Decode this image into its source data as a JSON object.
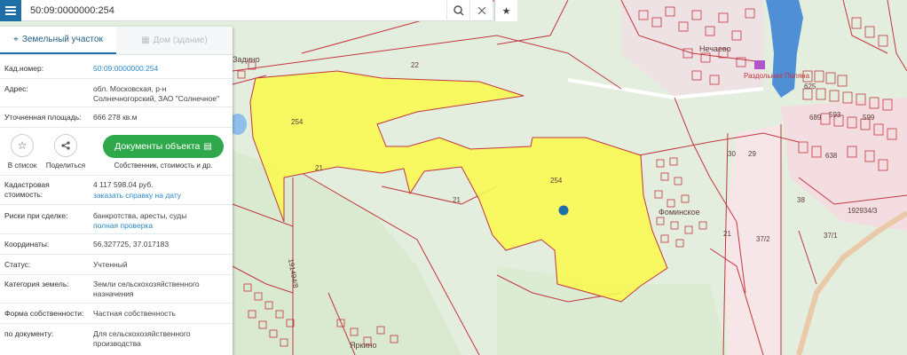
{
  "search": {
    "value": "50:09:0000000:254"
  },
  "tabs": {
    "land": "Земельный участок",
    "building": "Дом (здание)"
  },
  "fields": {
    "cad_label": "Кад.номер:",
    "cad_value": "50:09:0000000:254",
    "addr_label": "Адрес:",
    "addr_value": "обл. Московская, р-н Солнечногорский, ЗАО \"Солнечное\"",
    "area_label": "Уточненная площадь:",
    "area_value": "666 278 кв.м",
    "cost_label": "Кадастровая стоимость:",
    "cost_value": "4 117 598.04 руб.",
    "cost_link": "заказать справку на дату",
    "risk_label": "Риски при сделке:",
    "risk_value": "банкротства, аресты, суды",
    "risk_link": "полная проверка",
    "coord_label": "Координаты:",
    "coord_value": "56.327725, 37.017183",
    "status_label": "Статус:",
    "status_value": "Учтенный",
    "category_label": "Категория земель:",
    "category_value": "Земли сельскохозяйственного назначения",
    "ownership_label": "Форма собственности:",
    "ownership_value": "Частная собственность",
    "doc_label": "по документу:",
    "doc_value": "Для сельскохозяйственного производства"
  },
  "actions": {
    "list": "В список",
    "share": "Поделиться",
    "docs_button": "Документы объекта",
    "docs_sub": "Собственник, стоимость и др."
  },
  "map_labels": {
    "parcel1": "254",
    "parcel2": "254",
    "n22": "22",
    "n21a": "21",
    "n21b": "21",
    "n21c": "21",
    "n29": "29",
    "n30": "30",
    "n38": "38",
    "n372": "37/2",
    "n371": "37/1",
    "n192934": "192934/3",
    "n191494": "191494/8",
    "n638": "638",
    "n689": "689",
    "n593": "593",
    "n625": "625",
    "n599": "599",
    "village1": "Фоминское",
    "village2": "Яркино",
    "village3": "Задино",
    "village4": "Нечаево",
    "place": "Раздольная Поляна"
  },
  "colors": {
    "accent": "#1e6fa8",
    "green_button": "#2ea84a",
    "highlight": "#fbf94f",
    "parcel_border": "#c2353f",
    "water": "#4f8fd6"
  }
}
